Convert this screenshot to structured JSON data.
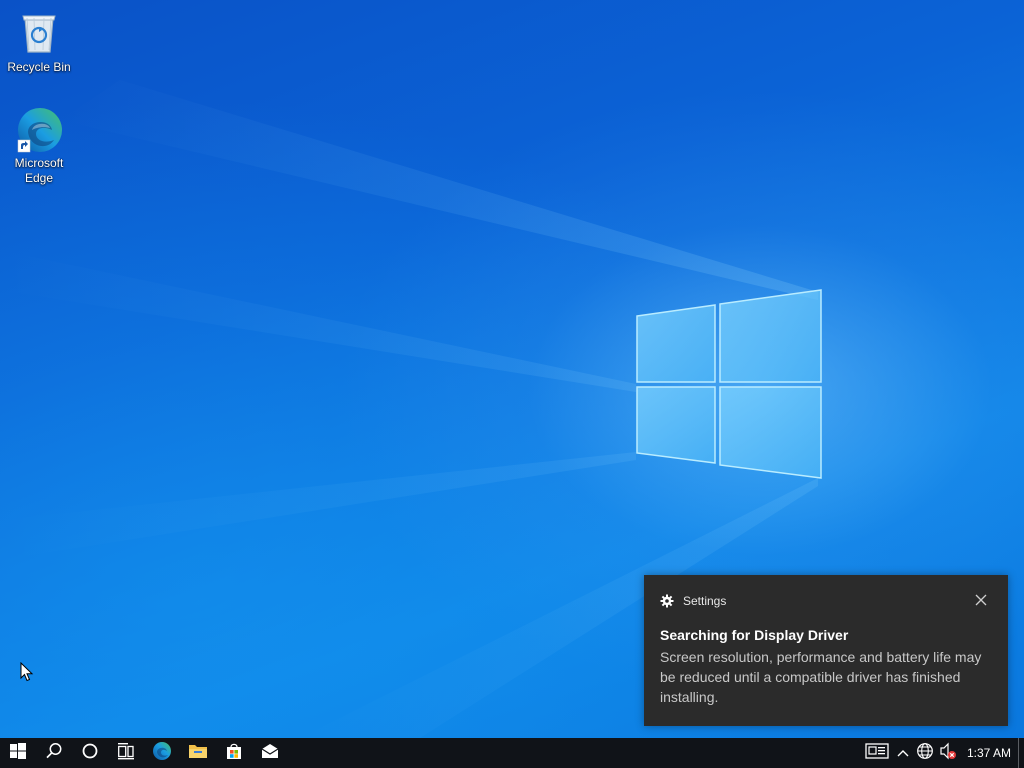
{
  "desktop": {
    "icons": [
      {
        "label": "Recycle Bin",
        "icon": "recycle-bin-icon"
      },
      {
        "label": "Microsoft\nEdge",
        "icon": "edge-icon"
      }
    ]
  },
  "toast": {
    "app_name": "Settings",
    "app_icon": "gear-icon",
    "title": "Searching for Display Driver",
    "body": "Screen resolution, performance and battery life may be reduced until a compatible driver has finished installing.",
    "close_icon": "close-icon"
  },
  "taskbar": {
    "pinned": [
      "start-icon",
      "search-icon",
      "cortana-icon",
      "task-view-icon",
      "edge-icon",
      "file-explorer-icon",
      "store-icon",
      "mail-icon"
    ],
    "tray": {
      "icons": [
        "news-icon",
        "chevron-up-icon",
        "network-icon",
        "volume-muted-icon"
      ],
      "time": "1:37 AM"
    }
  },
  "colors": {
    "desktop_accent": "#0b63d6",
    "toast_bg": "#2b2b2b",
    "taskbar_bg": "#101318",
    "edge_blue": "#0c74d4",
    "edge_green": "#47c26a",
    "folder_yellow": "#f2c04a"
  }
}
